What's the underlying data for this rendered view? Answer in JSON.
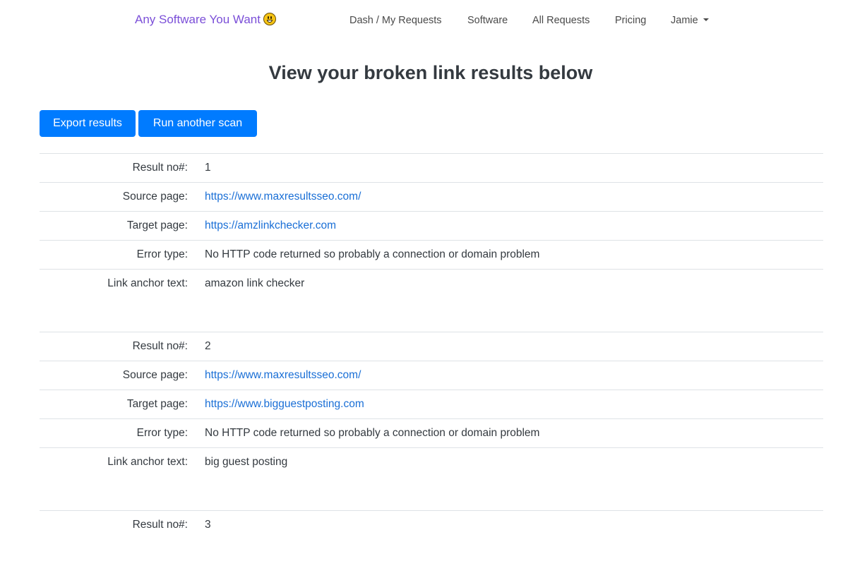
{
  "nav": {
    "brand": "Any Software You Want",
    "brand_emoji": "grinning-face-icon",
    "links": [
      {
        "label": "Dash / My Requests"
      },
      {
        "label": "Software"
      },
      {
        "label": "All Requests"
      },
      {
        "label": "Pricing"
      },
      {
        "label": "Jamie"
      }
    ]
  },
  "page": {
    "title": "View your broken link results below"
  },
  "actions": {
    "export_label": "Export results",
    "rescan_label": "Run another scan"
  },
  "labels": {
    "result_no": "Result no#:",
    "source": "Source page:",
    "target": "Target page:",
    "error": "Error type:",
    "anchor": "Link anchor text:"
  },
  "results": [
    {
      "number": "1",
      "source": "https://www.maxresultsseo.com/",
      "target": "https://amzlinkchecker.com",
      "error": "No HTTP code returned so probably a connection or domain problem",
      "anchor": "amazon link checker"
    },
    {
      "number": "2",
      "source": "https://www.maxresultsseo.com/",
      "target": "https://www.bigguestposting.com",
      "error": "No HTTP code returned so probably a connection or domain problem",
      "anchor": "big guest posting"
    },
    {
      "number": "3"
    }
  ],
  "colors": {
    "brand": "#7b4fd8",
    "primary_button": "#007bff",
    "link": "#1a6fd6"
  }
}
